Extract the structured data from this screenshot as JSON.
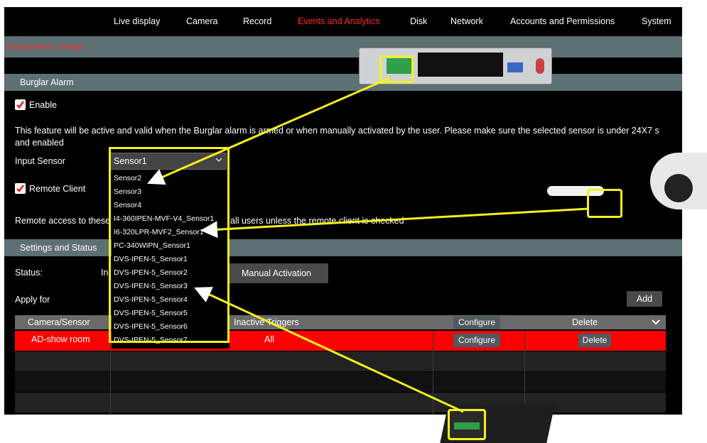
{
  "nav": {
    "items": [
      "Live display",
      "Camera",
      "Record",
      "Events and Analytics",
      "Disk",
      "Network",
      "Accounts and Permissions",
      "System"
    ],
    "active_index": 3
  },
  "page": {
    "title": "Burglar Alarm Linkage"
  },
  "burglar_alarm": {
    "section_title": "Burglar Alarm",
    "enable_label": "Enable",
    "enable_checked": true,
    "description_line1": "This feature will be active and valid when the Burglar alarm is armed or when manually activated by the user. Please make sure the selected sensor is under 24X7 s",
    "description_line2": "and enabled",
    "input_sensor_label": "Input Sensor",
    "input_sensor_value": "Sensor1",
    "remote_client_label": "Remote Client",
    "remote_client_checked": true,
    "remote_access_text_a": "Remote access to these",
    "remote_access_text_b": "all users unless the remote client is checked"
  },
  "sensor_options": [
    "Sensor2",
    "Sensor3",
    "Sensor4",
    "I4-360IPEN-MVF-V4_Sensor1",
    "I6-320LPR-MVF2_Sensor1",
    "PC-340WIPN_Sensor1",
    "DVS-IPEN-5_Sensor1",
    "DVS-IPEN-5_Sensor2",
    "DVS-IPEN-5_Sensor3",
    "DVS-IPEN-5_Sensor4",
    "DVS-IPEN-5_Sensor5",
    "DVS-IPEN-5_Sensor6",
    "DVS-IPEN-5_Sensor7"
  ],
  "settings": {
    "section_title": "Settings and Status",
    "status_label": "Status:",
    "status_value_fragment": "In",
    "manual_activation_label": "Manual Activation",
    "apply_for_label": "Apply for",
    "add_label": "Add"
  },
  "table": {
    "headers": {
      "camera": "Camera/Sensor",
      "triggers": "Inactive Triggers",
      "configure": "Configure",
      "delete": "Delete"
    },
    "rows": [
      {
        "camera": "AD-show room",
        "triggers": "All",
        "configure": "Configure",
        "delete": "Delete"
      }
    ]
  },
  "colors": {
    "accent_red": "#ff2b2b",
    "section_bar": "#5d7074",
    "highlight_row": "#ff0000",
    "callout_yellow": "#f3f21a"
  }
}
